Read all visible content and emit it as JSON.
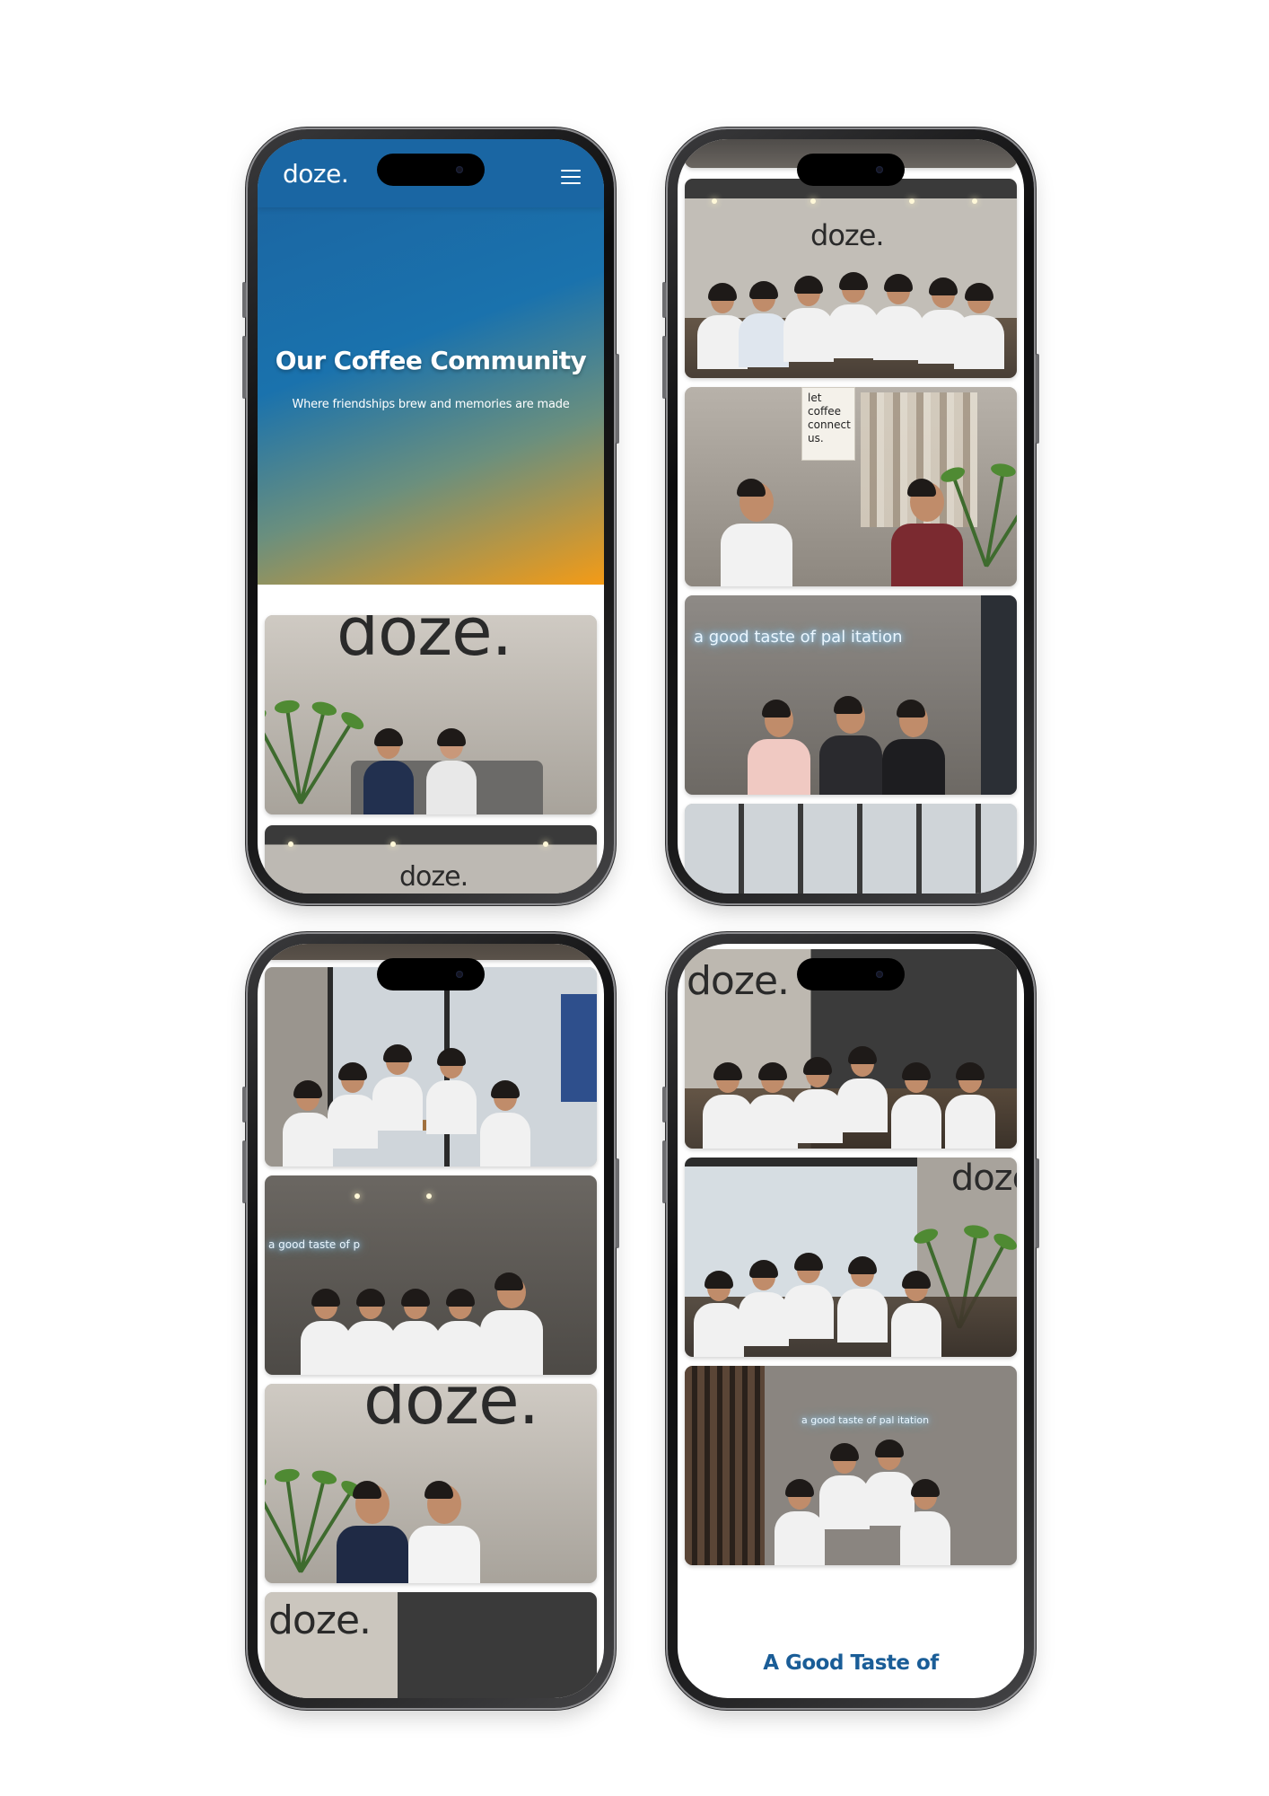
{
  "site": {
    "brand": "doze.",
    "hero_title": "Our Coffee Community",
    "hero_subtitle": "Where friendships brew and memories are made",
    "section_heading_partial": "A Good Taste of"
  },
  "photo_signs": {
    "doze": "doze.",
    "poster": "let coffee connect us.",
    "neon": "a good taste of pal itation",
    "neon_small": "a good taste of p"
  },
  "colors": {
    "hero_blue": "#1c63a0",
    "hero_orange": "#f49b16",
    "heading_blue": "#1a5d97"
  },
  "icons": [
    "menu-icon"
  ]
}
